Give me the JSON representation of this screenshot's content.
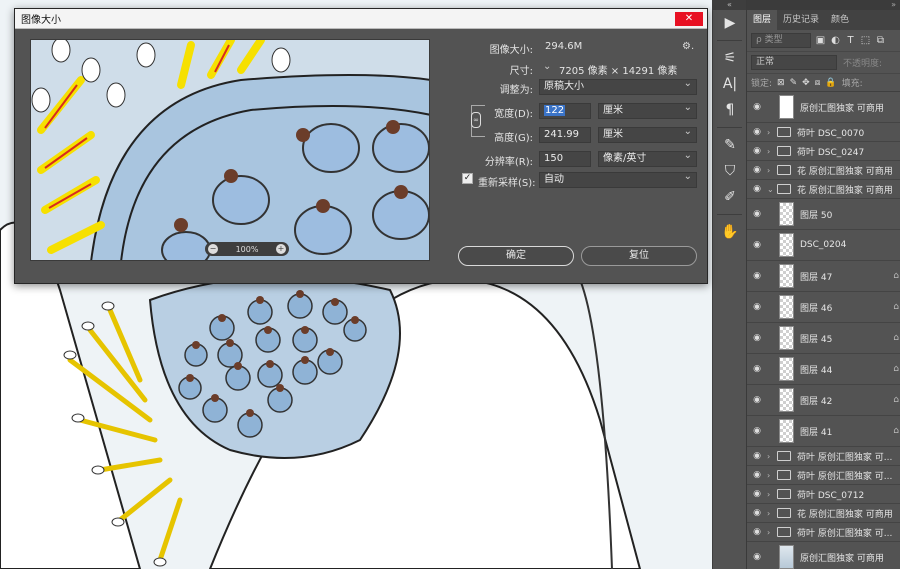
{
  "dialog": {
    "title": "图像大小",
    "close": "✕",
    "image_size_label": "图像大小:",
    "image_size_value": "294.6M",
    "dimensions_label": "尺寸:",
    "dimensions_value": "7205 像素 × 14291 像素",
    "fit_to_label": "调整为:",
    "fit_to_value": "原稿大小",
    "width_label": "宽度(D):",
    "width_value": "122",
    "width_unit": "厘米",
    "height_label": "高度(G):",
    "height_value": "241.99",
    "height_unit": "厘米",
    "resolution_label": "分辨率(R):",
    "resolution_value": "150",
    "resolution_unit": "像素/英寸",
    "resample_label": "重新采样(S):",
    "resample_checked": "✓",
    "resample_value": "自动",
    "zoom_value": "100%",
    "zoom_out": "−",
    "zoom_in": "+",
    "ok_label": "确定",
    "reset_label": "复位"
  },
  "panel": {
    "tabs": [
      "图层",
      "历史记录",
      "颜色"
    ],
    "filter_placeholder": "类型",
    "blend_mode": "正常",
    "opacity_label": "不透明度:",
    "lock_label": "锁定:",
    "fill_label": "填充:"
  },
  "layers": [
    {
      "name": "原创汇图独家 可商用",
      "type": "thumb-white",
      "size": "tall"
    },
    {
      "name": "荷叶 DSC_0070",
      "type": "folder",
      "size": "short"
    },
    {
      "name": "荷叶 DSC_0247",
      "type": "folder",
      "size": "short"
    },
    {
      "name": "花 原创汇图独家 可商用",
      "type": "folder",
      "size": "short"
    },
    {
      "name": "花 原创汇图独家 可商用",
      "type": "folder-open",
      "size": "short"
    },
    {
      "name": "图层 50",
      "type": "thumb",
      "size": "tall"
    },
    {
      "name": "DSC_0204",
      "type": "thumb",
      "size": "tall"
    },
    {
      "name": "图层 47",
      "type": "thumb",
      "size": "tall"
    },
    {
      "name": "图层 46",
      "type": "thumb",
      "size": "tall"
    },
    {
      "name": "图层 45",
      "type": "thumb",
      "size": "tall"
    },
    {
      "name": "图层 44",
      "type": "thumb",
      "size": "tall"
    },
    {
      "name": "图层 42",
      "type": "thumb",
      "size": "tall"
    },
    {
      "name": "图层 41",
      "type": "thumb",
      "size": "tall"
    },
    {
      "name": "荷叶 原创汇图独家 可...",
      "type": "folder",
      "size": "short"
    },
    {
      "name": "荷叶 原创汇图独家 可...",
      "type": "folder",
      "size": "short"
    },
    {
      "name": "荷叶 DSC_0712",
      "type": "folder",
      "size": "short"
    },
    {
      "name": "花 原创汇图独家 可商用",
      "type": "folder",
      "size": "short"
    },
    {
      "name": "荷叶 原创汇图独家 可...",
      "type": "folder",
      "size": "short"
    },
    {
      "name": "原创汇图独家 可商用",
      "type": "thumb-art",
      "size": "tall"
    }
  ],
  "icons": {
    "eye": "◉",
    "lock": "🔒",
    "arrow": "›",
    "gear": "⚙"
  },
  "colors": {
    "panel_bg": "#535353",
    "accent_selection": "#3b74c8",
    "close_red": "#e81123",
    "flower_yellow": "#f6e000",
    "lotus_blue": "#9fbfdd"
  }
}
